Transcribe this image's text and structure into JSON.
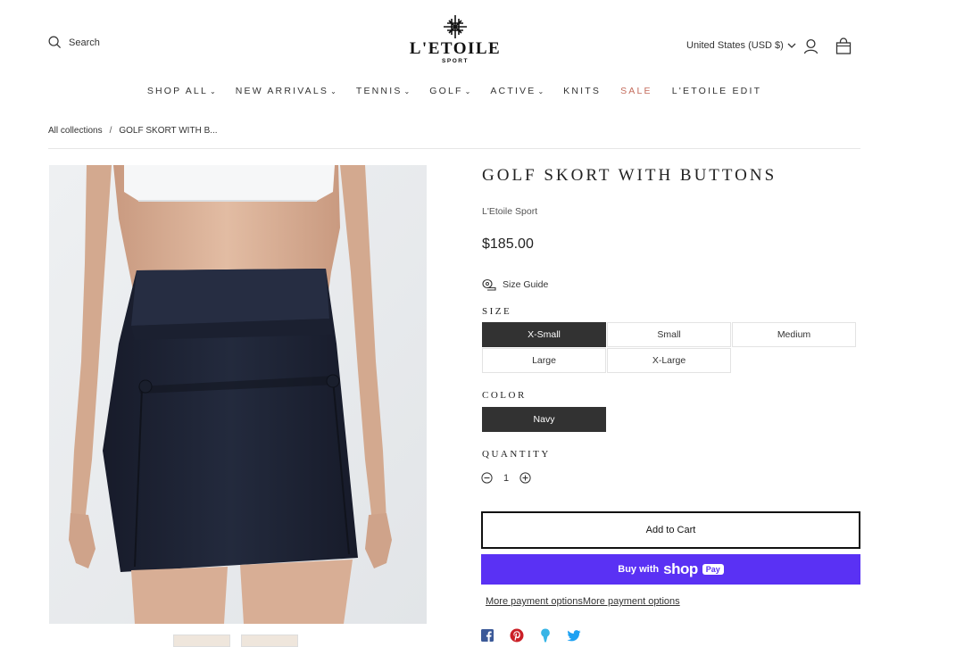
{
  "header": {
    "search_label": "Search",
    "logo_name": "L'ETOILE",
    "logo_sub": "SPORT",
    "currency": "United States (USD $)"
  },
  "nav": {
    "items": [
      {
        "label": "SHOP ALL",
        "dropdown": true
      },
      {
        "label": "NEW ARRIVALS",
        "dropdown": true
      },
      {
        "label": "TENNIS",
        "dropdown": true
      },
      {
        "label": "GOLF",
        "dropdown": true
      },
      {
        "label": "ACTIVE",
        "dropdown": true
      },
      {
        "label": "KNITS",
        "dropdown": false
      },
      {
        "label": "SALE",
        "dropdown": false
      },
      {
        "label": "L'ETOILE EDIT",
        "dropdown": false
      }
    ]
  },
  "breadcrumb": {
    "root": "All collections",
    "separator": "/",
    "current": "GOLF SKORT WITH B..."
  },
  "product": {
    "title": "GOLF SKORT WITH BUTTONS",
    "vendor": "L'Etoile Sport",
    "price": "$185.00",
    "size_guide": "Size Guide",
    "size_label": "SIZE",
    "sizes": [
      "X-Small",
      "Small",
      "Medium",
      "Large",
      "X-Large"
    ],
    "selected_size": "X-Small",
    "color_label": "COLOR",
    "colors": [
      "Navy"
    ],
    "selected_color": "Navy",
    "quantity_label": "QUANTITY",
    "quantity": "1",
    "add_to_cart": "Add to Cart",
    "buy_with": "Buy with",
    "shop_text": "shop",
    "pay_text": "Pay",
    "more_payment": "More payment optionsMore payment options"
  },
  "colors": {
    "selected_bg": "#323232",
    "shop_pay": "#5a31f4",
    "sale": "#c46c5c",
    "skort": "#1e2233"
  },
  "social_icons": [
    "facebook-icon",
    "pinterest-icon",
    "pin-icon",
    "twitter-icon"
  ]
}
